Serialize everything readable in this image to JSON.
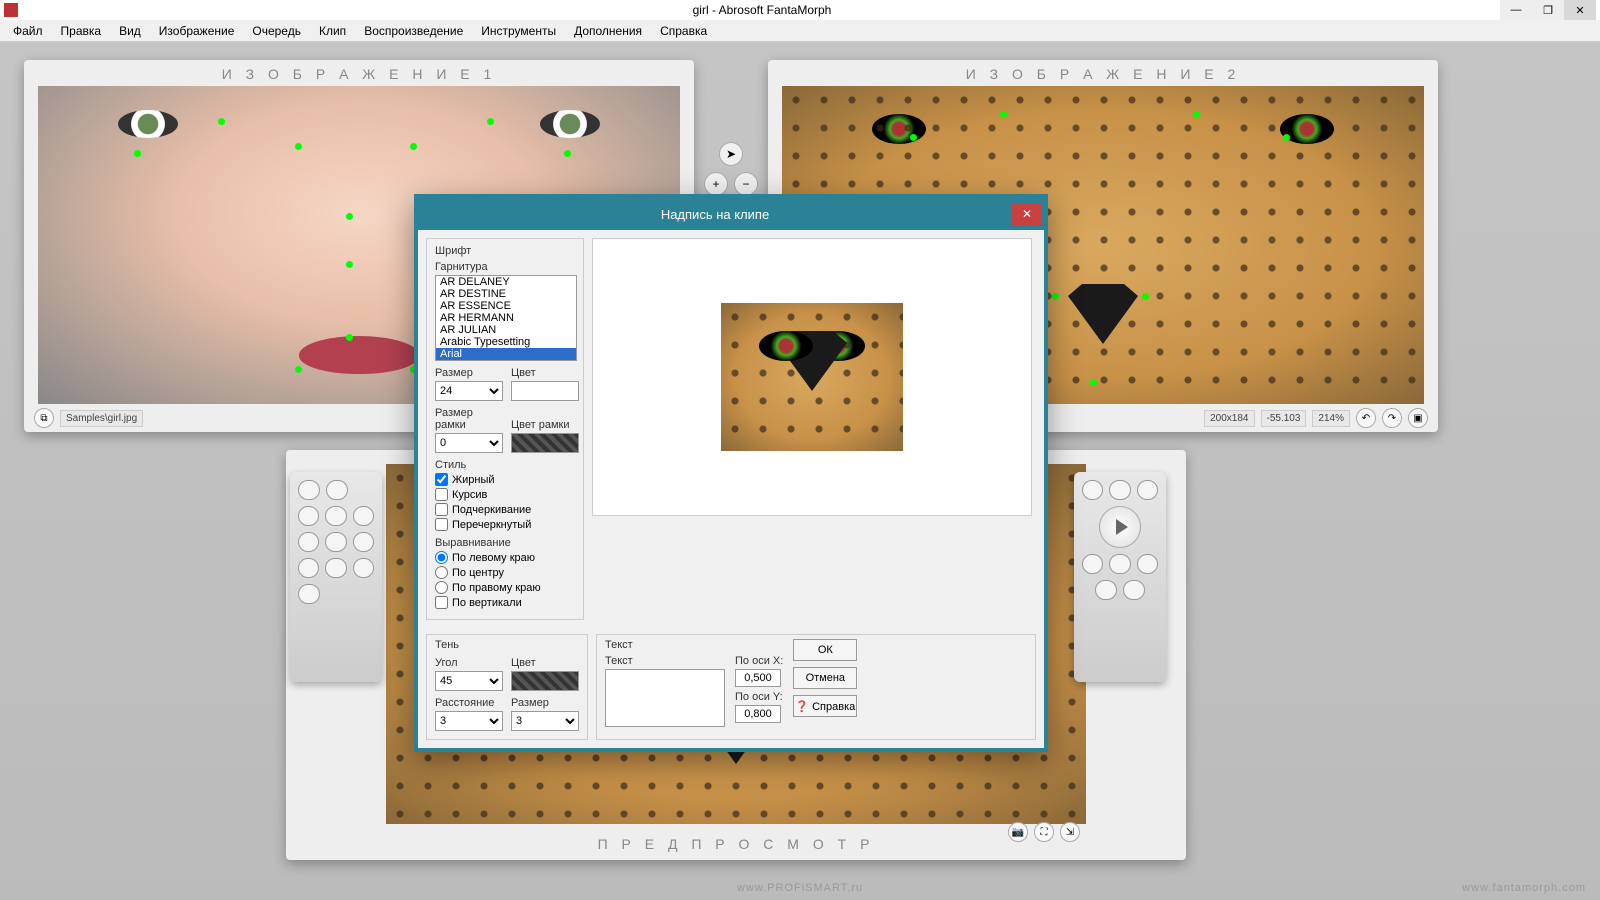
{
  "window": {
    "title": "girl - Abrosoft FantaMorph",
    "minimize": "—",
    "maximize": "❐",
    "close": "✕"
  },
  "menu": {
    "items": [
      "Файл",
      "Правка",
      "Вид",
      "Изображение",
      "Очередь",
      "Клип",
      "Воспроизведение",
      "Инструменты",
      "Дополнения",
      "Справка"
    ]
  },
  "panel1": {
    "title": "И З О Б Р А Ж Е Н И Е 1",
    "path": "Samples\\girl.jpg"
  },
  "panel2": {
    "title": "И З О Б Р А Ж Е Н И Е 2",
    "dim": "200x184",
    "angle": "-55.103",
    "zoom": "214%"
  },
  "preview": {
    "title": "П Р Е Д П Р О С М О Т Р"
  },
  "dialog": {
    "title": "Надпись на клипе",
    "font_group": "Шрифт",
    "typeface_label": "Гарнитура",
    "fonts": [
      "AR DELANEY",
      "AR DESTINE",
      "AR ESSENCE",
      "AR HERMANN",
      "AR JULIAN",
      "Arabic Typesetting",
      "Arial"
    ],
    "font_selected": "Arial",
    "size_label": "Размер",
    "size_value": "24",
    "color_label": "Цвет",
    "border_size_label": "Размер рамки",
    "border_size_value": "0",
    "border_color_label": "Цвет рамки",
    "style_label": "Стиль",
    "bold": "Жирный",
    "italic": "Курсив",
    "underline": "Подчеркивание",
    "strike": "Перечеркнутый",
    "align_label": "Выравнивание",
    "align_left": "По левому краю",
    "align_center": "По центру",
    "align_right": "По правому краю",
    "align_vert": "По вертикали",
    "shadow": {
      "group": "Тень",
      "angle_label": "Угол",
      "angle": "45",
      "color_label": "Цвет",
      "distance_label": "Расстояние",
      "distance": "3",
      "size_label": "Размер",
      "size": "3"
    },
    "text": {
      "group": "Текст",
      "label": "Текст",
      "value": "",
      "x_label": "По оси X:",
      "x": "0,500",
      "y_label": "По оси Y:",
      "y": "0,800"
    },
    "ok": "ОК",
    "cancel": "Отмена",
    "help": "Справка"
  },
  "watermark": {
    "center": "www.PROFiSMART.ru",
    "right": "www.fantamorph.com"
  }
}
